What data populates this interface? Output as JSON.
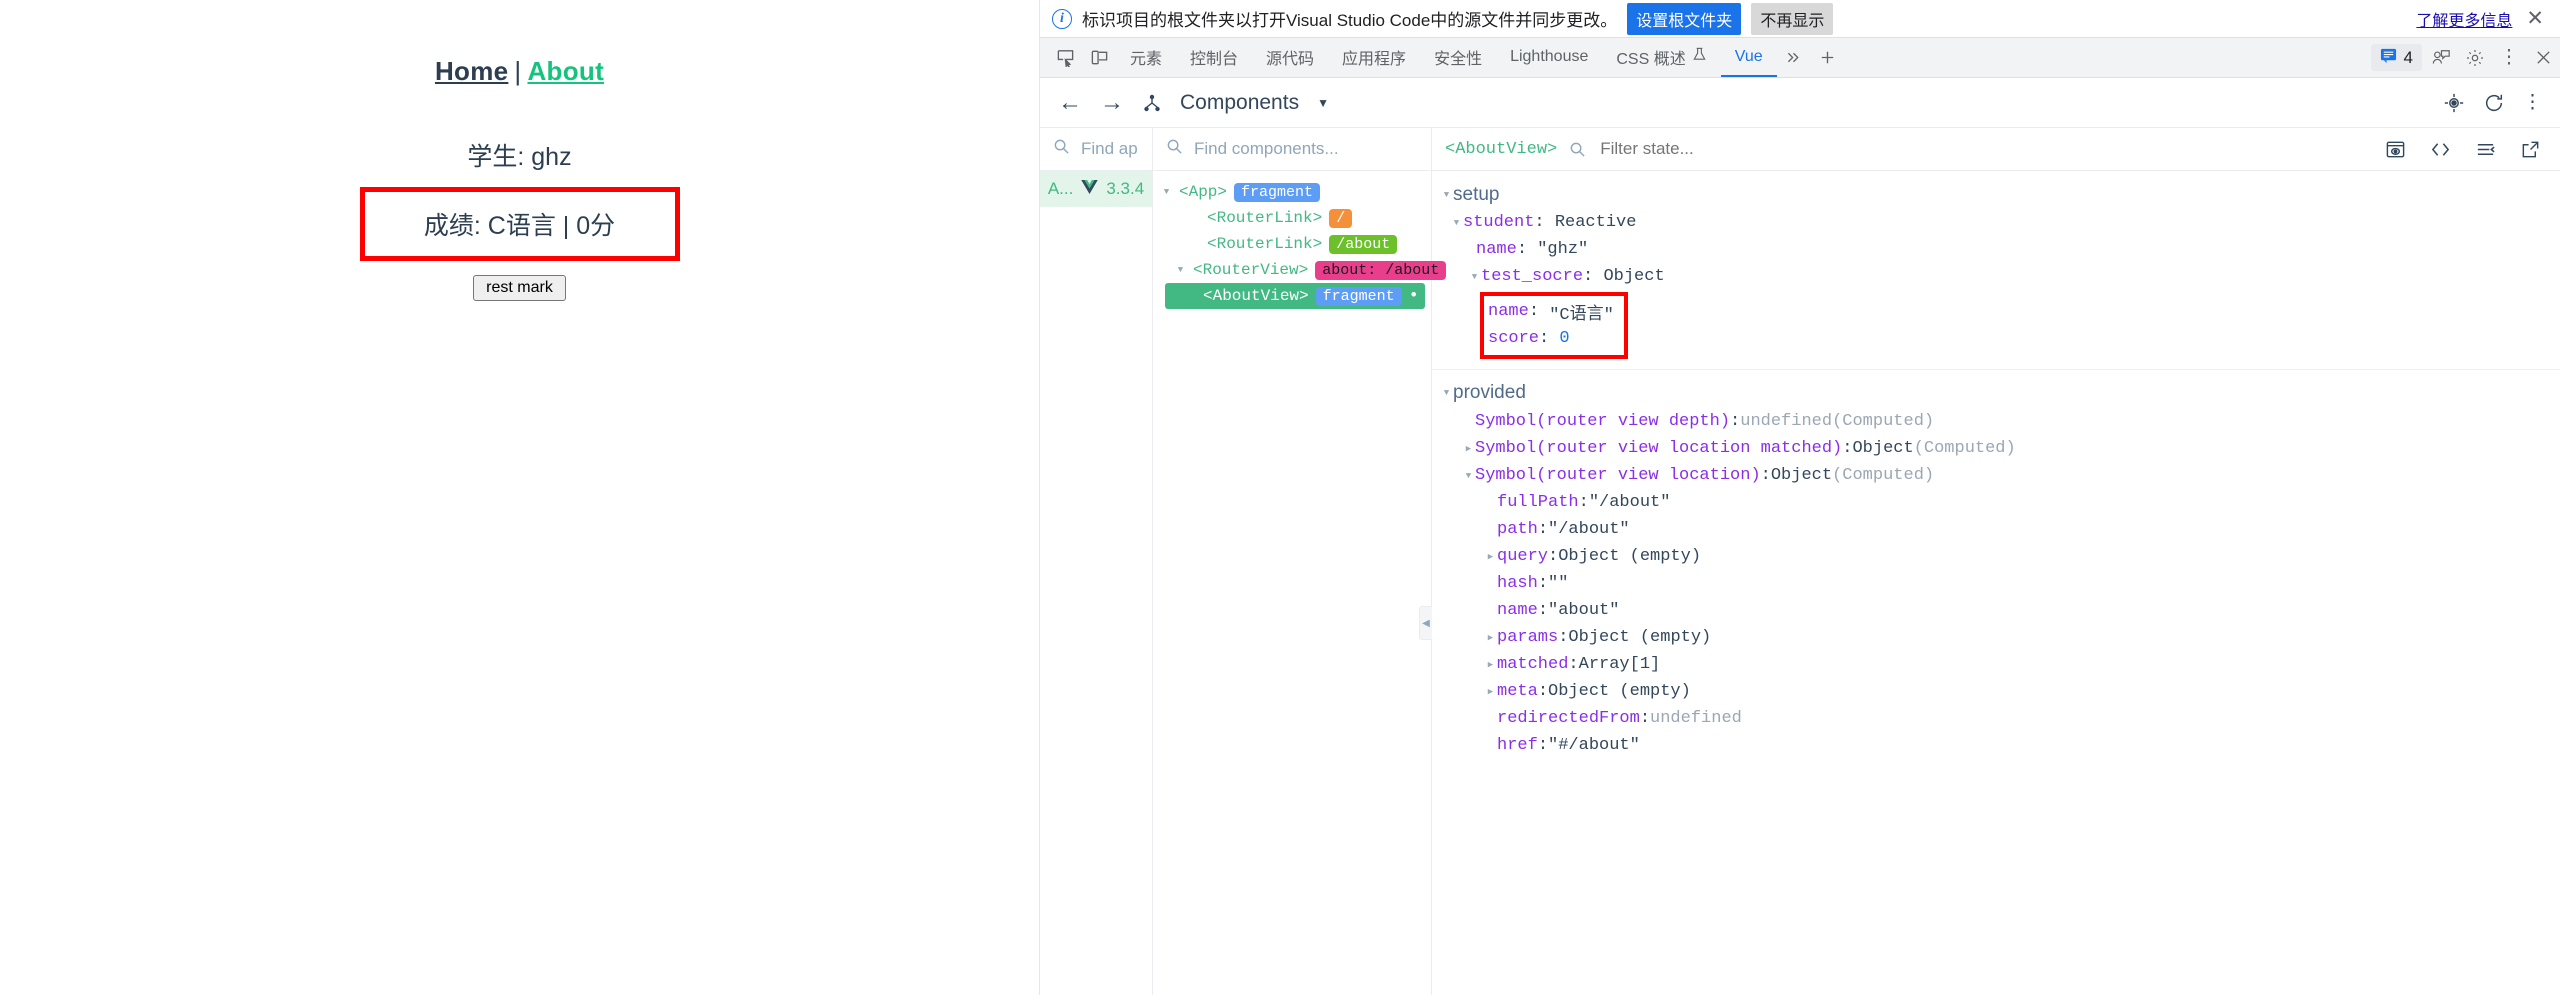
{
  "webpage": {
    "nav": {
      "home": "Home",
      "separator": "|",
      "about": "About"
    },
    "student_line": "学生: ghz",
    "mark_line": "成绩: C语言 | 0分",
    "reset_button": "rest mark"
  },
  "devtools": {
    "infobar": {
      "message": "标识项目的根文件夹以打开Visual Studio Code中的源文件并同步更改。",
      "primary_button": "设置根文件夹",
      "secondary_button": "不再显示",
      "learn_more": "了解更多信息",
      "accent_color": "#1a73e8"
    },
    "tabs": [
      {
        "label": "元素",
        "active": false
      },
      {
        "label": "控制台",
        "active": false
      },
      {
        "label": "源代码",
        "active": false
      },
      {
        "label": "应用程序",
        "active": false
      },
      {
        "label": "安全性",
        "active": false
      },
      {
        "label": "Lighthouse",
        "active": false
      },
      {
        "label": "CSS 概述",
        "active": false,
        "beaker": true
      },
      {
        "label": "Vue",
        "active": true
      }
    ],
    "issues_count": "4",
    "vue_panel": {
      "title": "Components",
      "app_search_placeholder": "Find app",
      "component_search_placeholder": "Find components...",
      "state_filter_placeholder": "Filter state...",
      "selected_component": "<AboutView>",
      "app_entry": {
        "name": "A...",
        "version": "3.3.4"
      },
      "tree": [
        {
          "indent": 0,
          "tri": "down",
          "tag": "<App>",
          "badges": [
            {
              "text": "fragment",
              "kind": "fragment"
            }
          ],
          "selected": false
        },
        {
          "indent": 1,
          "tri": "none",
          "tag": "<RouterLink>",
          "badges": [
            {
              "text": "/",
              "kind": "slash"
            }
          ],
          "selected": false
        },
        {
          "indent": 1,
          "tri": "none",
          "tag": "<RouterLink>",
          "badges": [
            {
              "text": "/about",
              "kind": "about"
            }
          ],
          "selected": false
        },
        {
          "indent": 1,
          "tri": "down",
          "tag": "<RouterView>",
          "badges": [
            {
              "text": "about: /about",
              "kind": "route"
            }
          ],
          "selected": false
        },
        {
          "indent": 2,
          "tri": "none",
          "tag": "<AboutView>",
          "badges": [
            {
              "text": "fragment",
              "kind": "fragment"
            }
          ],
          "selected": true,
          "dot": "•"
        }
      ],
      "state": {
        "setup": {
          "label": "setup",
          "student_key": "student",
          "student_type": "Reactive",
          "name_key": "name",
          "name_value": "\"ghz\"",
          "test_key": "test_socre",
          "test_type": "Object",
          "score_name_key": "name",
          "score_name_value": "\"C语言\"",
          "score_key": "score",
          "score_value": "0"
        },
        "provided": {
          "label": "provided",
          "rows": [
            {
              "key": "Symbol(router view depth)",
              "value": "undefined",
              "value_kind": "undef",
              "suffix": "(Computed)",
              "tri": "none",
              "indent": 2
            },
            {
              "key": "Symbol(router view location matched)",
              "value": "Object",
              "value_kind": "type",
              "suffix": "(Computed)",
              "tri": "right",
              "indent": 2
            },
            {
              "key": "Symbol(router view location)",
              "value": "Object",
              "value_kind": "type",
              "suffix": "(Computed)",
              "tri": "down",
              "indent": 2
            },
            {
              "key": "fullPath",
              "value": "\"/about\"",
              "value_kind": "str",
              "suffix": "",
              "tri": "none",
              "indent": 3
            },
            {
              "key": "path",
              "value": "\"/about\"",
              "value_kind": "str",
              "suffix": "",
              "tri": "none",
              "indent": 3
            },
            {
              "key": "query",
              "value": "Object (empty)",
              "value_kind": "type",
              "suffix": "",
              "tri": "right",
              "indent": 3
            },
            {
              "key": "hash",
              "value": "\"\"",
              "value_kind": "str",
              "suffix": "",
              "tri": "none",
              "indent": 3
            },
            {
              "key": "name",
              "value": "\"about\"",
              "value_kind": "str",
              "suffix": "",
              "tri": "none",
              "indent": 3
            },
            {
              "key": "params",
              "value": "Object (empty)",
              "value_kind": "type",
              "suffix": "",
              "tri": "right",
              "indent": 3
            },
            {
              "key": "matched",
              "value": "Array[1]",
              "value_kind": "type",
              "suffix": "",
              "tri": "right",
              "indent": 3
            },
            {
              "key": "meta",
              "value": "Object (empty)",
              "value_kind": "type",
              "suffix": "",
              "tri": "right",
              "indent": 3
            },
            {
              "key": "redirectedFrom",
              "value": "undefined",
              "value_kind": "undef",
              "suffix": "",
              "tri": "none",
              "indent": 3
            },
            {
              "key": "href",
              "value": "\"#/about\"",
              "value_kind": "str",
              "suffix": "",
              "tri": "none",
              "indent": 3
            }
          ]
        }
      }
    }
  }
}
